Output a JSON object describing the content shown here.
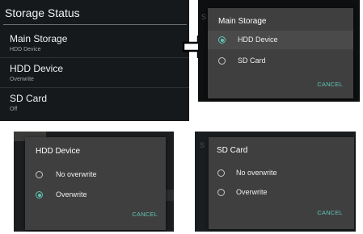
{
  "settings": {
    "title": "Storage Status",
    "items": [
      {
        "title": "Main Storage",
        "summary": "HDD Device"
      },
      {
        "title": "HDD Device",
        "summary": "Overwrite"
      },
      {
        "title": "SD Card",
        "summary": "Off"
      }
    ]
  },
  "main_storage_dialog": {
    "title": "Main Storage",
    "options": [
      {
        "label": "HDD Device",
        "selected": true
      },
      {
        "label": "SD Card",
        "selected": false
      }
    ],
    "cancel_label": "CANCEL"
  },
  "hdd_device_dialog": {
    "title": "HDD Device",
    "options": [
      {
        "label": "No overwrite",
        "selected": false
      },
      {
        "label": "Overwrite",
        "selected": true
      }
    ],
    "cancel_label": "CANCEL"
  },
  "sd_card_dialog": {
    "title": "SD Card",
    "options": [
      {
        "label": "No overwrite",
        "selected": false
      },
      {
        "label": "Overwrite",
        "selected": false
      }
    ],
    "cancel_label": "CANCEL"
  },
  "colors": {
    "accent": "#5fc4b6",
    "dialog_bg": "#3f3f3f",
    "settings_bg": "#15191c"
  }
}
